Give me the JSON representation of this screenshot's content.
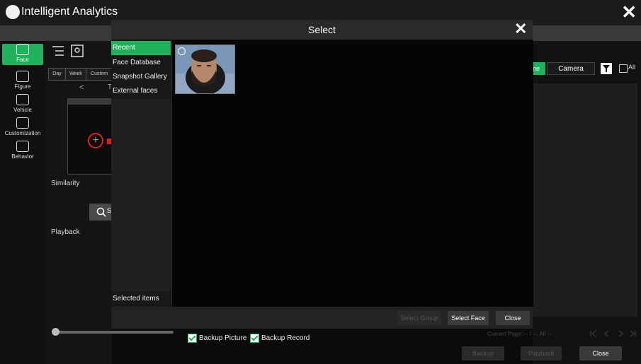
{
  "app": {
    "title": "Intelligent Analytics",
    "close": "✕"
  },
  "nav": [
    {
      "label": "Face",
      "icon": "face-icon",
      "active": true
    },
    {
      "label": "Figure",
      "icon": "figure-icon"
    },
    {
      "label": "Vehicle",
      "icon": "vehicle-icon"
    },
    {
      "label": "Customization",
      "icon": "customization-icon"
    },
    {
      "label": "Behavior",
      "icon": "behavior-icon"
    }
  ],
  "left": {
    "tabs": [
      "Day",
      "Week",
      "Custom"
    ],
    "prev": "<",
    "today_partial": "T",
    "add": "+",
    "similarity": "Similarity",
    "search_partial": "S",
    "playback": "Playback"
  },
  "right": {
    "tab_partial": "ne",
    "camera": "Camera",
    "all": "All"
  },
  "dialog": {
    "title": "Select",
    "close": "✕",
    "side_items": [
      "Recent",
      "Face Database",
      "Snapshot Gallery",
      "External faces"
    ],
    "selected_items": "Selected items",
    "buttons": {
      "select_group": "Select Group",
      "select_face": "Select Face",
      "close": "Close"
    }
  },
  "bottom": {
    "backup_picture": "Backup Picture",
    "backup_record": "Backup Record",
    "page_info": "Current Page: -- / --, All --",
    "backup": "Backup",
    "playback": "Playback",
    "close": "Close"
  },
  "colors": {
    "accent": "#1fb15b",
    "red": "#e02020"
  }
}
